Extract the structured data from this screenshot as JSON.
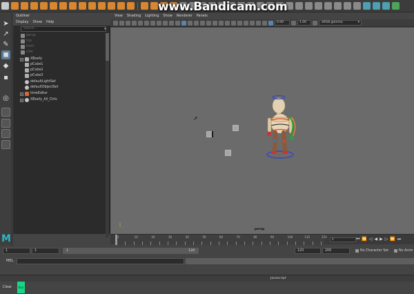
{
  "watermark": "www.Bandicam.com",
  "outliner": {
    "title": "Outliner",
    "menu": [
      "Display",
      "Show",
      "Help"
    ],
    "search_placeholder": "Search...",
    "items": [
      {
        "label": "persp",
        "dim": true
      },
      {
        "label": "top",
        "dim": true
      },
      {
        "label": "front",
        "dim": true
      },
      {
        "label": "side",
        "dim": true
      },
      {
        "label": "XBoefy",
        "dim": false
      },
      {
        "label": "pCube1",
        "dim": false
      },
      {
        "label": "pCube2",
        "dim": false
      },
      {
        "label": "pCube3",
        "dim": false
      },
      {
        "label": "defaultLightSet",
        "dim": false
      },
      {
        "label": "defaultObjectSet",
        "dim": false
      },
      {
        "label": "timeEditor",
        "dim": false
      },
      {
        "label": "XBoefy_All_Ctrls",
        "dim": false
      }
    ]
  },
  "viewport": {
    "menu": [
      "View",
      "Shading",
      "Lighting",
      "Show",
      "Renderer",
      "Panels"
    ],
    "exposure": "0.00",
    "gamma": "1.00",
    "color_space": "sRGB gamma",
    "camera_label": "persp"
  },
  "timeline": {
    "ticks": [
      "1",
      "5",
      "10",
      "15",
      "20",
      "25",
      "30",
      "35",
      "40",
      "45",
      "50",
      "55",
      "60",
      "65",
      "70",
      "75",
      "80",
      "85",
      "90",
      "95",
      "100",
      "105",
      "110",
      "115",
      "120"
    ],
    "current_frame": "1"
  },
  "range": {
    "start_field": "1",
    "start_inner": "1",
    "range_left": "1",
    "range_right": "120",
    "end_inner": "120",
    "end_field": "200",
    "character_set": "No Character Set",
    "anim_layer": "No Anim"
  },
  "command": {
    "label": "MEL"
  },
  "script_editor": {
    "header": "Javascript",
    "clear_label": "Clear",
    "run_label": "Run"
  },
  "colors": {
    "viewport_bg": "#6b6b6b",
    "ui_bg": "#444444",
    "accent": "#5a84ad",
    "run": "#19d684"
  }
}
